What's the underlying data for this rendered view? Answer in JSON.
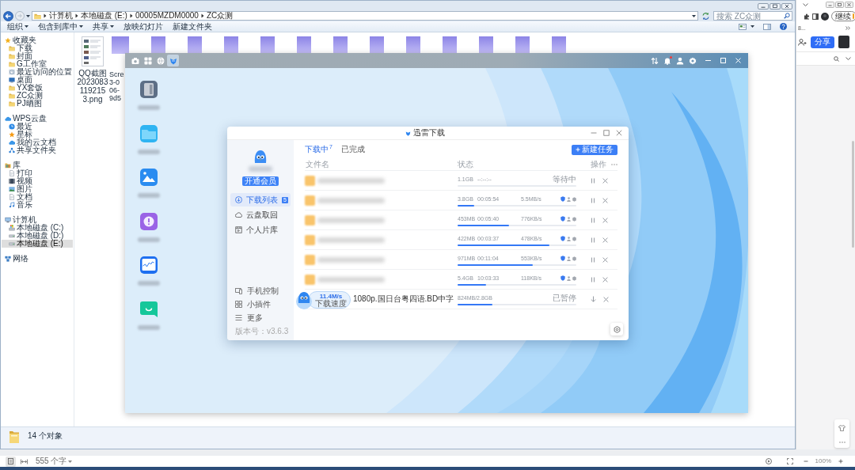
{
  "explorer": {
    "address": {
      "path": [
        "计算机",
        "本地磁盘 (E:)",
        "00005MZDM0000",
        "ZC众测"
      ]
    },
    "search": {
      "placeholder": "搜索 ZC众测"
    },
    "toolbar": [
      {
        "label": "组织",
        "dropdown": true
      },
      {
        "label": "包含到库中",
        "dropdown": true
      },
      {
        "label": "共享",
        "dropdown": true
      },
      {
        "label": "放映幻灯片",
        "dropdown": false
      },
      {
        "label": "新建文件夹",
        "dropdown": false
      }
    ],
    "nav": [
      {
        "label": "收藏夹",
        "kind": "favorites",
        "selected": false,
        "children": [
          {
            "label": "下载",
            "kind": "folder",
            "selected": false
          },
          {
            "label": "封面",
            "kind": "folder",
            "selected": false
          },
          {
            "label": "G工作室",
            "kind": "folder",
            "selected": false
          },
          {
            "label": "最近访问的位置",
            "kind": "recent",
            "selected": false
          },
          {
            "label": "桌面",
            "kind": "desktop",
            "selected": false
          },
          {
            "label": "YX套饭",
            "kind": "folder",
            "selected": false
          },
          {
            "label": "ZC众测",
            "kind": "folder",
            "selected": false
          },
          {
            "label": "PJ晒图",
            "kind": "folder",
            "selected": false
          }
        ]
      },
      {
        "label": "WPS云盘",
        "kind": "cloud",
        "selected": false,
        "children": [
          {
            "label": "最近",
            "kind": "clock",
            "selected": false
          },
          {
            "label": "星标",
            "kind": "star",
            "selected": false
          },
          {
            "label": "我的云文档",
            "kind": "cloud",
            "selected": false
          },
          {
            "label": "共享文件夹",
            "kind": "share",
            "selected": false
          }
        ]
      },
      {
        "label": "库",
        "kind": "library",
        "selected": false,
        "children": [
          {
            "label": "打印",
            "kind": "page",
            "selected": false
          },
          {
            "label": "视频",
            "kind": "video",
            "selected": false
          },
          {
            "label": "图片",
            "kind": "picture",
            "selected": false
          },
          {
            "label": "文档",
            "kind": "document",
            "selected": false
          },
          {
            "label": "音乐",
            "kind": "music",
            "selected": false
          }
        ]
      },
      {
        "label": "计算机",
        "kind": "computer",
        "selected": false,
        "children": [
          {
            "label": "本地磁盘 (C:)",
            "kind": "system-drive",
            "selected": false
          },
          {
            "label": "本地磁盘 (D:)",
            "kind": "drive",
            "selected": false
          },
          {
            "label": "本地磁盘 (E:)",
            "kind": "drive",
            "selected": true
          }
        ]
      },
      {
        "label": "网络",
        "kind": "network",
        "selected": false
      }
    ],
    "files": [
      {
        "kind": "labeled",
        "label": "QQ截图20230831192153.png"
      },
      {
        "kind": "cut",
        "label_lines": [
          "Scre",
          "3-0",
          "06-",
          "9d5"
        ]
      },
      {
        "kind": "covered"
      },
      {
        "kind": "covered"
      },
      {
        "kind": "covered"
      },
      {
        "kind": "covered"
      },
      {
        "kind": "covered"
      },
      {
        "kind": "covered"
      },
      {
        "kind": "covered"
      },
      {
        "kind": "covered"
      },
      {
        "kind": "covered"
      },
      {
        "kind": "covered"
      },
      {
        "kind": "covered"
      },
      {
        "kind": "covered"
      }
    ],
    "status": "14 个对象"
  },
  "nas": {
    "apps": [
      {
        "kind": "camera",
        "selected": false
      },
      {
        "kind": "grid",
        "selected": false
      },
      {
        "kind": "globe",
        "selected": false
      },
      {
        "kind": "bird",
        "selected": true
      }
    ],
    "tray": [
      {
        "kind": "transfer",
        "notification": false
      },
      {
        "kind": "bell",
        "notification": true
      },
      {
        "kind": "user",
        "notification": false
      },
      {
        "kind": "settings",
        "notification": false
      }
    ],
    "desktop_icons": [
      {
        "kind": "nas-device"
      },
      {
        "kind": "folder"
      },
      {
        "kind": "photos"
      },
      {
        "kind": "alert"
      },
      {
        "kind": "chart"
      },
      {
        "kind": "chat"
      }
    ]
  },
  "download": {
    "title": "迅雷下载",
    "vip_button": "开通会员",
    "nav": [
      {
        "label": "下载列表",
        "kind": "download",
        "selected": true,
        "count": "5"
      },
      {
        "label": "云盘取回",
        "kind": "cloud",
        "selected": false
      },
      {
        "label": "个人片库",
        "kind": "library",
        "selected": false
      }
    ],
    "tools": [
      {
        "label": "手机控制",
        "kind": "devices"
      },
      {
        "label": "小插件",
        "kind": "widgets"
      },
      {
        "label": "更多",
        "kind": "more"
      }
    ],
    "version": "版本号：v3.6.3",
    "tabs": [
      {
        "label": "下载中",
        "count": "7",
        "selected": true
      },
      {
        "label": "已完成",
        "selected": false
      }
    ],
    "new_task_button": "新建任务",
    "columns": [
      "文件名",
      "状态",
      "操作"
    ],
    "rows": [
      {
        "kind": "waiting",
        "size": "1.1GB",
        "time": "--:--:--",
        "status": "等待中",
        "level": 0
      },
      {
        "kind": "downloading",
        "size": "3.8GB",
        "time": "00:05:54",
        "speed": "5.5MB/s",
        "level": 0.14
      },
      {
        "kind": "downloading",
        "size": "453MB",
        "time": "00:05:40",
        "speed": "776KB/s",
        "level": 0.43
      },
      {
        "kind": "downloading",
        "size": "422MB",
        "time": "00:03:37",
        "speed": "478KB/s",
        "level": 0.77
      },
      {
        "kind": "downloading",
        "size": "971MB",
        "time": "00:11:04",
        "speed": "553KB/s",
        "level": 0.63
      },
      {
        "kind": "downloading",
        "size": "5.4GB",
        "time": "10:03:33",
        "speed": "118KB/s",
        "level": 0.24
      },
      {
        "kind": "paused",
        "name": "1080p.国日台粤四语.BD中字",
        "size": "824MB/2.8GB",
        "status": "已暂停",
        "level": 0.29
      }
    ],
    "speed_widget": {
      "speed": "11.4M/s",
      "label": "下载速度"
    }
  },
  "browser_panel": {
    "resume_button": "继续",
    "bookmark": "8...",
    "share_button": "分享"
  },
  "editor_status": {
    "word_count": "555 个字",
    "zoom": "100%"
  }
}
